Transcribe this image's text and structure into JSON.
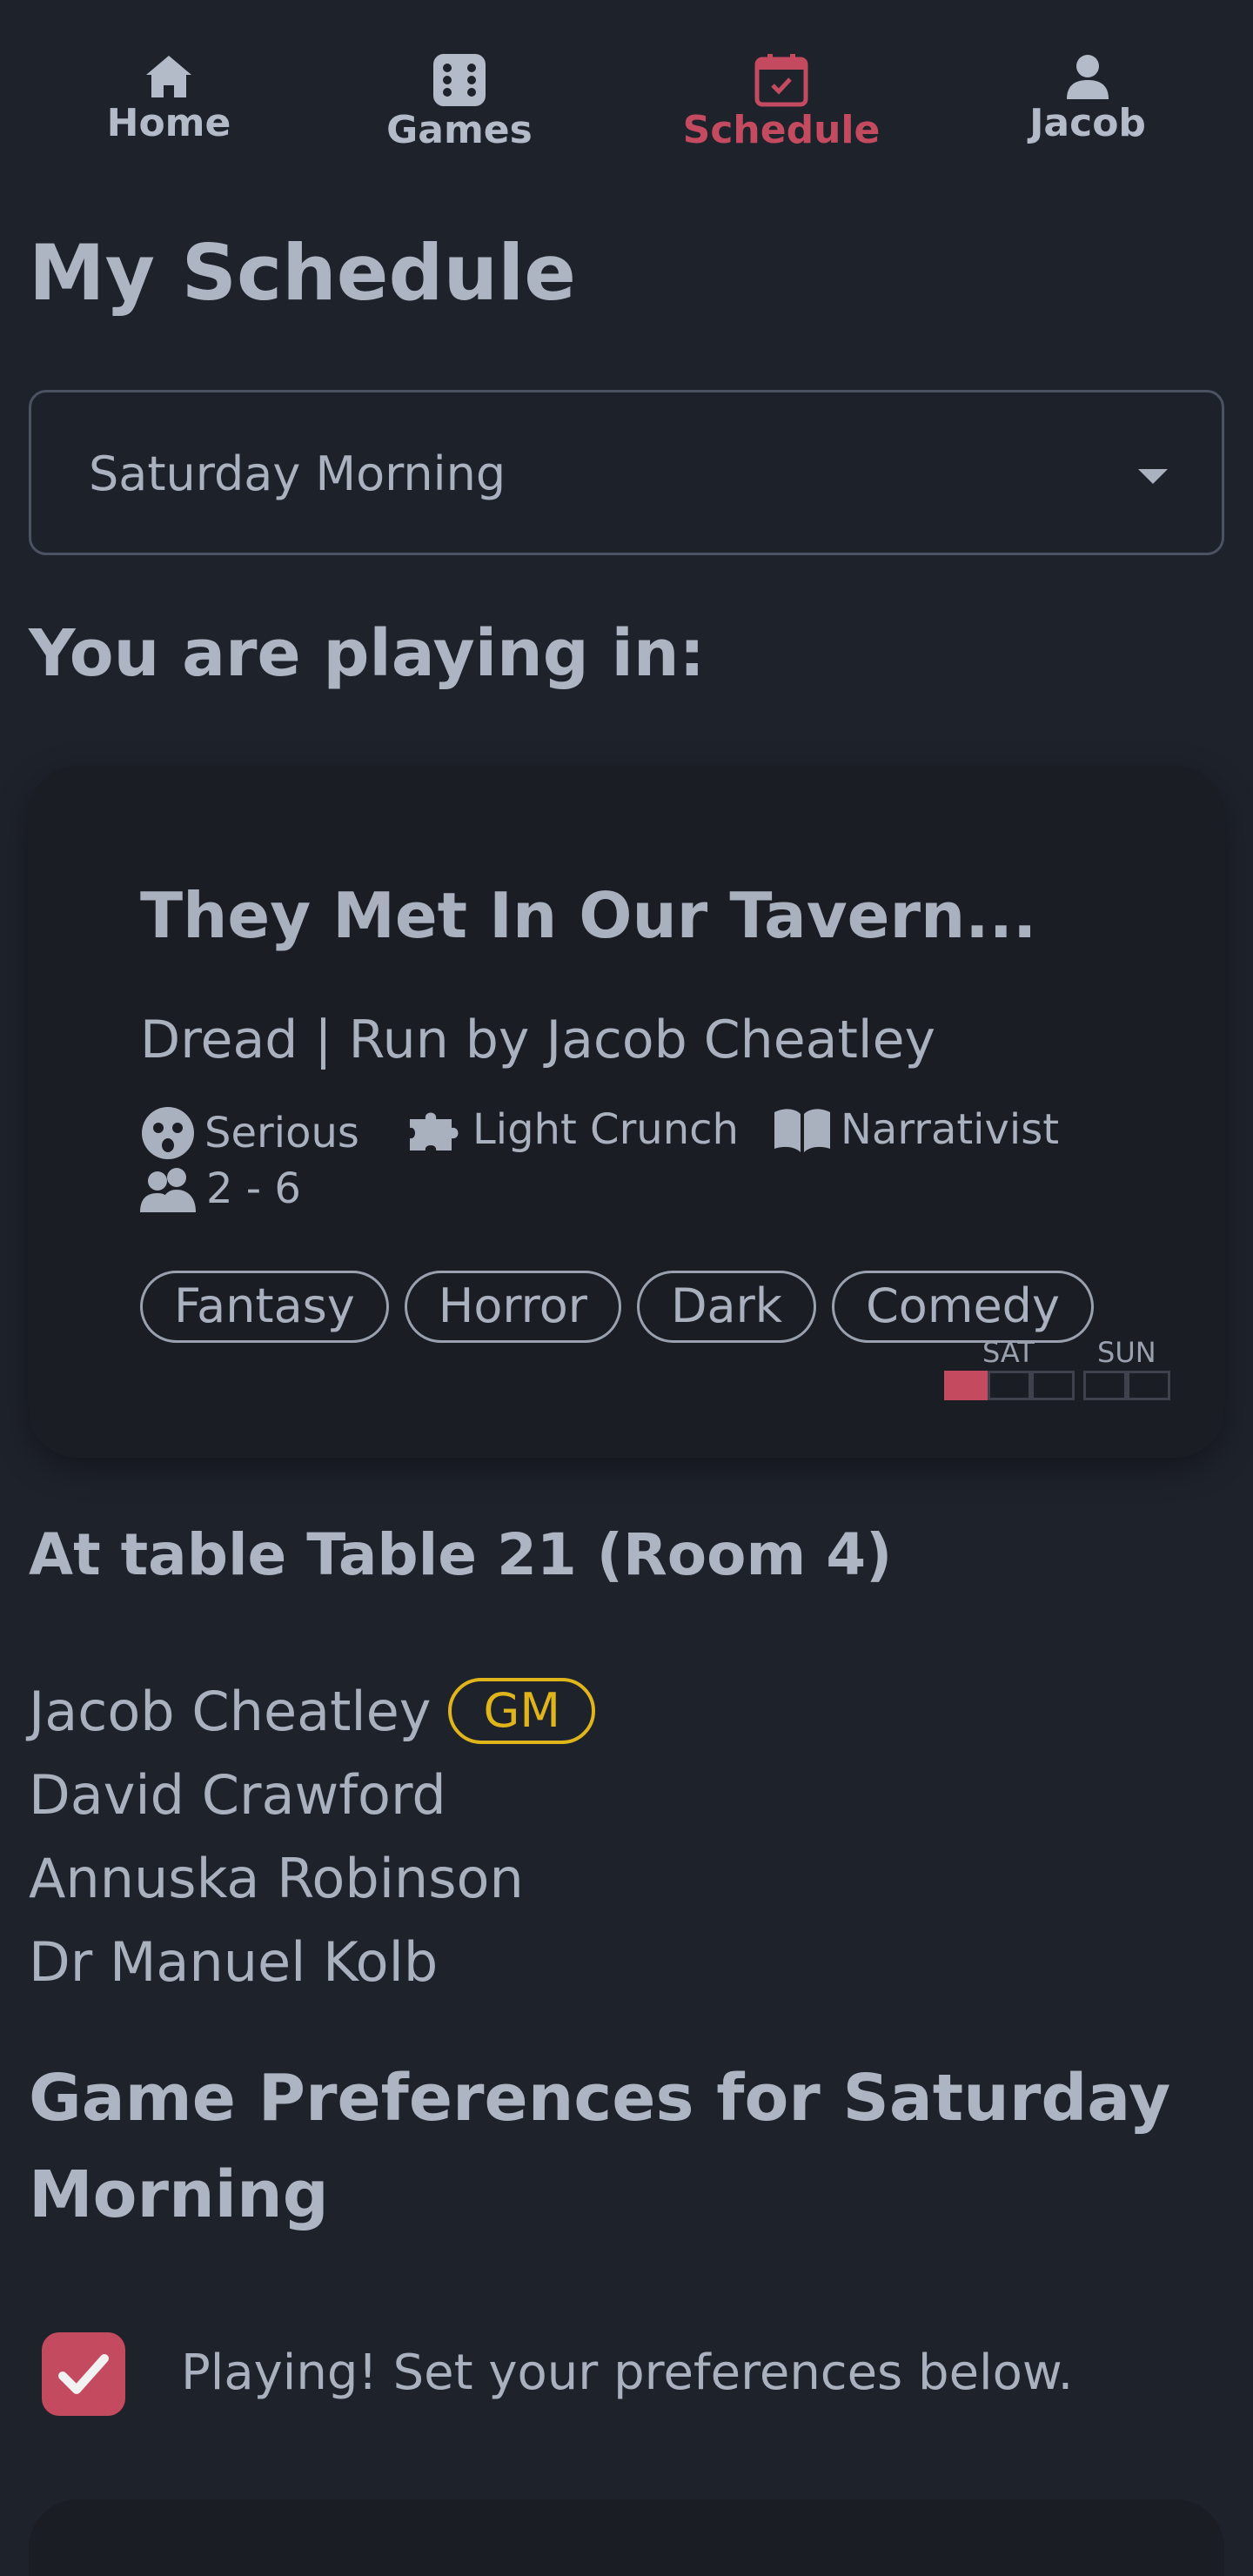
{
  "nav": {
    "items": [
      {
        "label": "Home",
        "icon": "home-icon"
      },
      {
        "label": "Games",
        "icon": "dice-icon"
      },
      {
        "label": "Schedule",
        "icon": "calendar-check-icon",
        "active": true
      },
      {
        "label": "Jacob",
        "icon": "user-icon"
      }
    ]
  },
  "page_title": "My Schedule",
  "session_select": {
    "value": "Saturday Morning"
  },
  "playing_heading": "You are playing in:",
  "game_card": {
    "title": "They Met In Our Tavern...",
    "subtitle": "Dread | Run by Jacob Cheatley",
    "attributes": {
      "tone": "Serious",
      "crunch": "Light Crunch",
      "style": "Narrativist",
      "players": "2 - 6"
    },
    "tags": [
      "Fantasy",
      "Horror",
      "Dark",
      "Comedy"
    ],
    "slots": {
      "sat_label": "SAT",
      "sun_label": "SUN"
    }
  },
  "table_heading": "At table Table 21 (Room 4)",
  "players": [
    {
      "name": "Jacob Cheatley",
      "badge": "GM"
    },
    {
      "name": "David Crawford"
    },
    {
      "name": "Annuska Robinson"
    },
    {
      "name": "Dr Manuel Kolb"
    }
  ],
  "preferences_heading": "Game Preferences for Saturday Morning",
  "playing_checkbox": {
    "label": "Playing! Set your preferences below.",
    "checked": true
  },
  "colors": {
    "background": "#1e222b",
    "card": "#1a1d24",
    "accent": "#c34a5f",
    "gm_badge": "#e0b51c",
    "text": "#aab1be"
  }
}
